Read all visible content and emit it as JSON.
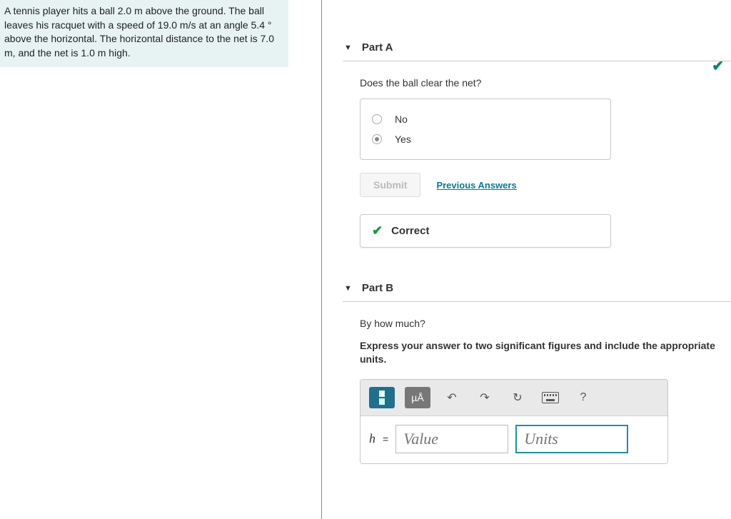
{
  "problem": {
    "text": "A tennis player hits a ball 2.0 m above the ground. The ball leaves his racquet with a speed of 19.0 m/s at an angle 5.4 ° above the horizontal. The horizontal distance to the net is 7.0 m, and the net is 1.0 m high."
  },
  "partA": {
    "label": "Part A",
    "question": "Does the ball clear the net?",
    "options": [
      "No",
      "Yes"
    ],
    "submit_label": "Submit",
    "prev_label": "Previous Answers",
    "correct_label": "Correct"
  },
  "partB": {
    "label": "Part B",
    "question": "By how much?",
    "instruction": "Express your answer to two significant figures and include the appropriate units.",
    "toolbar": {
      "units_btn": "µÅ",
      "help_btn": "?"
    },
    "var": "h",
    "eq": "=",
    "value_placeholder": "Value",
    "units_placeholder": "Units"
  }
}
